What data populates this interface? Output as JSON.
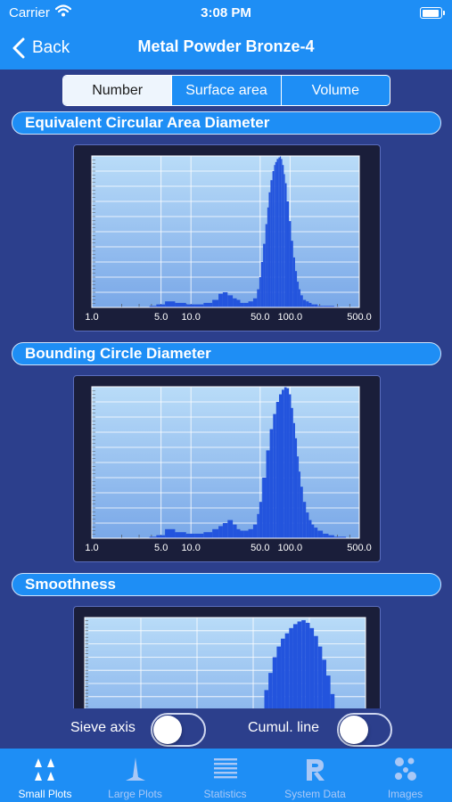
{
  "status_bar": {
    "carrier": "Carrier",
    "time": "3:08 PM"
  },
  "nav": {
    "back_label": "Back",
    "title": "Metal Powder Bronze-4"
  },
  "segmented": {
    "options": [
      "Number",
      "Surface area",
      "Volume"
    ],
    "selected": "Number"
  },
  "colors": {
    "accent": "#1e8ef5",
    "background": "#2c3f8c",
    "bars": "#2354dd",
    "plot_top": "#b9dcf8",
    "plot_bottom": "#7aa8e8"
  },
  "sections": [
    {
      "title": "Equivalent Circular Area Diameter"
    },
    {
      "title": "Bounding Circle Diameter"
    },
    {
      "title": "Smoothness"
    }
  ],
  "controls": {
    "sieve_axis_label": "Sieve axis",
    "sieve_axis_on": false,
    "cumul_line_label": "Cumul. line",
    "cumul_line_on": false
  },
  "tabs": [
    {
      "label": "Small Plots",
      "icon": "small-plots-icon",
      "active": true
    },
    {
      "label": "Large Plots",
      "icon": "large-plots-icon",
      "active": false
    },
    {
      "label": "Statistics",
      "icon": "statistics-icon",
      "active": false
    },
    {
      "label": "System Data",
      "icon": "system-data-icon",
      "active": false
    },
    {
      "label": "Images",
      "icon": "images-icon",
      "active": false
    }
  ],
  "chart_data": [
    {
      "type": "bar",
      "title": "Equivalent Circular Area Diameter",
      "xscale": "log",
      "xlim": [
        1,
        500
      ],
      "xticks": [
        "1.0",
        "5.0",
        "10.0",
        "50.0",
        "100.0",
        "500.0"
      ],
      "ylim": [
        0,
        100
      ],
      "grid": true,
      "x": [
        4,
        5,
        6,
        8,
        10,
        12,
        15,
        18,
        20,
        22,
        25,
        28,
        30,
        33,
        36,
        40,
        45,
        48,
        50,
        52,
        55,
        58,
        60,
        62,
        65,
        68,
        70,
        72,
        75,
        78,
        80,
        82,
        85,
        88,
        90,
        95,
        100,
        105,
        110,
        115,
        120,
        125,
        130,
        140,
        150,
        160,
        170,
        180,
        200,
        230,
        260,
        300
      ],
      "values": [
        1,
        2,
        4,
        3,
        2,
        2,
        3,
        5,
        9,
        10,
        8,
        6,
        5,
        3,
        3,
        4,
        6,
        12,
        20,
        30,
        42,
        55,
        66,
        76,
        84,
        90,
        94,
        96,
        98,
        99,
        100,
        98,
        94,
        88,
        82,
        70,
        57,
        44,
        33,
        24,
        17,
        12,
        8,
        5,
        4,
        3,
        2,
        2,
        1,
        1,
        1,
        0.5
      ]
    },
    {
      "type": "bar",
      "title": "Bounding Circle Diameter",
      "xscale": "log",
      "xlim": [
        1,
        500
      ],
      "xticks": [
        "1.0",
        "5.0",
        "10.0",
        "50.0",
        "100.0",
        "500.0"
      ],
      "ylim": [
        0,
        100
      ],
      "grid": true,
      "x": [
        4,
        5,
        6,
        8,
        10,
        12,
        15,
        18,
        20,
        22,
        25,
        28,
        30,
        33,
        36,
        40,
        45,
        48,
        50,
        55,
        60,
        65,
        70,
        75,
        80,
        85,
        90,
        95,
        100,
        105,
        110,
        115,
        120,
        125,
        130,
        140,
        150,
        160,
        170,
        180,
        200,
        230,
        260,
        300,
        350
      ],
      "values": [
        1,
        2,
        6,
        4,
        3,
        3,
        4,
        6,
        8,
        10,
        12,
        9,
        6,
        5,
        5,
        6,
        9,
        16,
        24,
        40,
        58,
        72,
        82,
        90,
        95,
        98,
        100,
        99,
        95,
        86,
        76,
        66,
        54,
        44,
        34,
        24,
        17,
        12,
        9,
        7,
        5,
        3,
        2,
        1,
        1
      ]
    },
    {
      "type": "bar",
      "title": "Smoothness",
      "ylim": [
        0,
        100
      ],
      "grid": true,
      "x": [
        0.6,
        0.61,
        0.62,
        0.63,
        0.64,
        0.65,
        0.66,
        0.67,
        0.68,
        0.69,
        0.7,
        0.71,
        0.72,
        0.73,
        0.74,
        0.75,
        0.76,
        0.77,
        0.78,
        0.79,
        0.8
      ],
      "values": [
        10,
        28,
        45,
        58,
        70,
        78,
        84,
        88,
        92,
        95,
        97,
        98,
        96,
        92,
        86,
        78,
        68,
        56,
        42,
        28,
        14
      ]
    }
  ]
}
